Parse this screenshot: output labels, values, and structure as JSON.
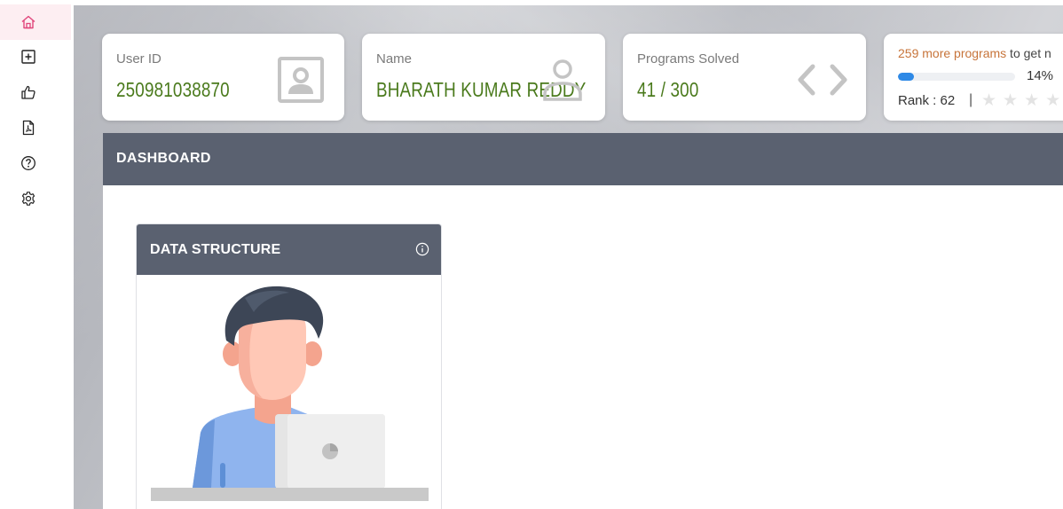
{
  "sidebar": {
    "items": [
      {
        "icon": "home-icon",
        "active": true
      },
      {
        "icon": "add-box-icon",
        "active": false
      },
      {
        "icon": "thumbs-up-icon",
        "active": false
      },
      {
        "icon": "pdf-document-icon",
        "active": false
      },
      {
        "icon": "help-icon",
        "active": false
      },
      {
        "icon": "gear-icon",
        "active": false
      }
    ],
    "accent": "#e0457b"
  },
  "stats": {
    "user_id": {
      "label": "User ID",
      "value": "250981038870",
      "icon": "id-card-icon"
    },
    "name": {
      "label": "Name",
      "value": "BHARATH KUMAR REDDY",
      "icon": "user-icon"
    },
    "programs": {
      "label": "Programs Solved",
      "value": "41 / 300",
      "icon": "code-brackets-icon"
    },
    "progress": {
      "more_highlight": "259 more programs",
      "more_rest": " to get n",
      "percent_text": "14%",
      "percent_value": 14,
      "rank_text": "Rank : 62",
      "separator": "|",
      "stars_filled": 0
    }
  },
  "dashboard": {
    "title": "DASHBOARD",
    "courses": [
      {
        "title": "DATA STRUCTURE",
        "info_icon": "info-icon"
      }
    ]
  },
  "colors": {
    "value_green": "#4a7a1c",
    "header_slate": "#5a6170",
    "progress_blue": "#2e89e6",
    "highlight_orange": "#c7743a"
  }
}
